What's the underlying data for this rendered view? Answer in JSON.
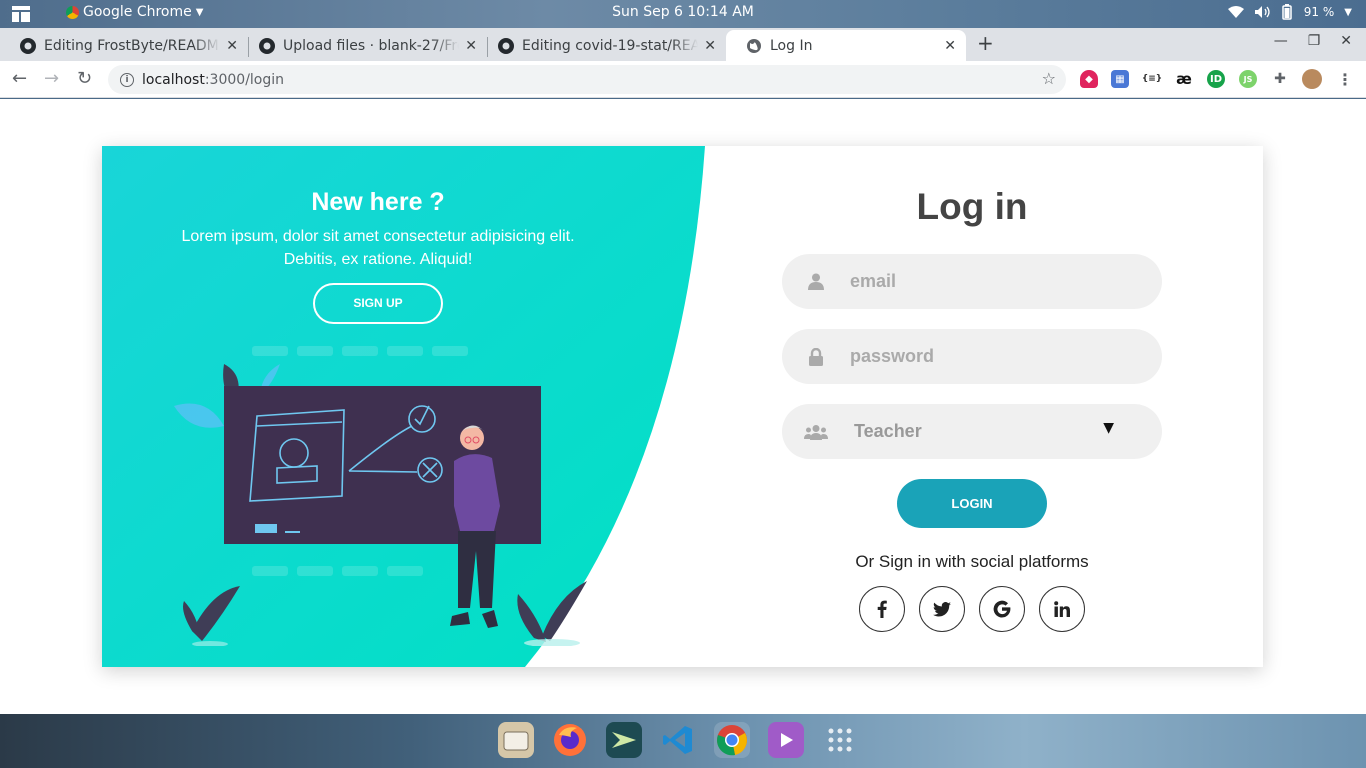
{
  "os_bar": {
    "app_name": "Google Chrome",
    "clock": "Sun Sep 6  10:14 AM",
    "battery": "91 %"
  },
  "browser": {
    "tabs": [
      {
        "title": "Editing FrostByte/READM",
        "icon": "github-icon",
        "active": false
      },
      {
        "title": "Upload files · blank-27/Fro",
        "icon": "github-icon",
        "active": false
      },
      {
        "title": "Editing covid-19-stat/REA",
        "icon": "github-icon",
        "active": false
      },
      {
        "title": "Log In",
        "icon": "globe-icon",
        "active": true
      }
    ],
    "url_host": "localhost",
    "url_path": ":3000/login"
  },
  "page": {
    "left": {
      "heading": "New here ?",
      "text": "Lorem ipsum, dolor sit amet consectetur adipisicing elit. Debitis, ex ratione. Aliquid!",
      "signup_label": "SIGN UP"
    },
    "form": {
      "title": "Log in",
      "email_placeholder": "email",
      "password_placeholder": "password",
      "role_selected": "Teacher",
      "login_label": "LOGIN",
      "social_text": "Or Sign in with social platforms",
      "social": [
        {
          "name": "facebook",
          "glyph": "f"
        },
        {
          "name": "twitter",
          "glyph": "t"
        },
        {
          "name": "google",
          "glyph": "G"
        },
        {
          "name": "linkedin",
          "glyph": "in"
        }
      ]
    }
  },
  "colors": {
    "accent_gradient_start": "#19d5d8",
    "accent_gradient_end": "#00e0c4",
    "login_button": "#1aa3b8"
  }
}
